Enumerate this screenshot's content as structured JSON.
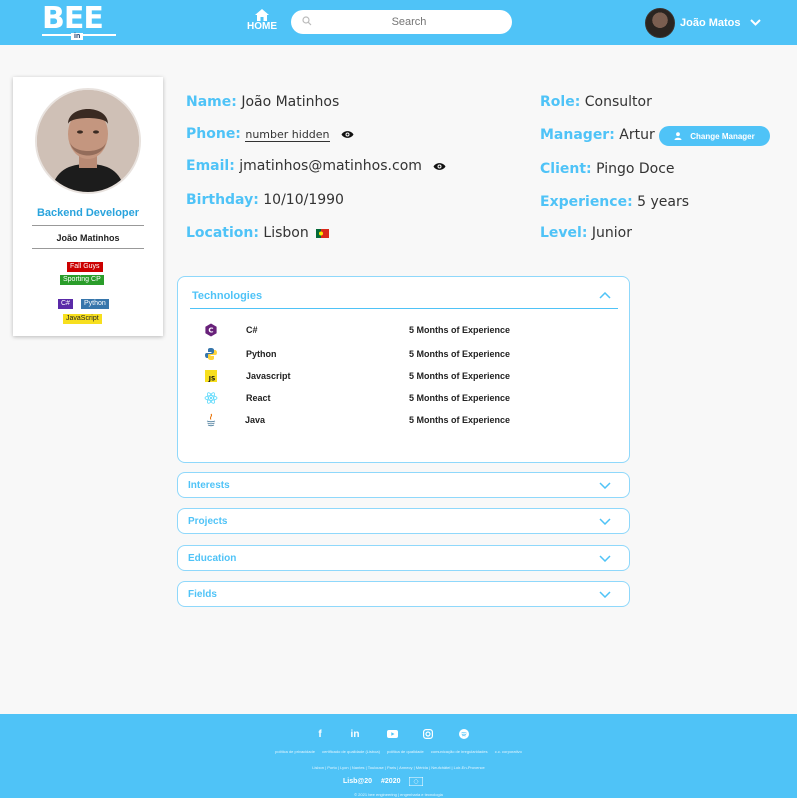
{
  "header": {
    "logo": "BEE",
    "logo_sub": "in",
    "home_label": "HOME",
    "search_placeholder": "Search",
    "user_name": "João Matos"
  },
  "profile": {
    "role": "Backend Developer",
    "name": "João Matinhos",
    "interest_tags": [
      "Fall Guys",
      "Sporting CP"
    ],
    "tech_tags": [
      "C#",
      "Python",
      "JavaScript"
    ]
  },
  "info": {
    "name_label": "Name:",
    "name_value": "João Matinhos",
    "phone_label": "Phone:",
    "phone_value": "number hidden",
    "email_label": "Email:",
    "email_value": "jmatinhos@matinhos.com",
    "birthday_label": "Birthday:",
    "birthday_value": "10/10/1990",
    "location_label": "Location:",
    "location_value": "Lisbon",
    "role_label": "Role:",
    "role_value": "Consultor",
    "manager_label": "Manager:",
    "manager_value": "Artur",
    "change_manager": "Change Manager",
    "client_label": "Client:",
    "client_value": "Pingo Doce",
    "experience_label": "Experience:",
    "experience_value": "5 years",
    "level_label": "Level:",
    "level_value": "Junior"
  },
  "technologies": {
    "title": "Technologies",
    "items": [
      {
        "name": "C#",
        "experience": "5 Months of Experience",
        "icon": "csharp-icon"
      },
      {
        "name": "Python",
        "experience": "5 Months of Experience",
        "icon": "python-icon"
      },
      {
        "name": "Javascript",
        "experience": "5 Months of Experience",
        "icon": "javascript-icon"
      },
      {
        "name": "React",
        "experience": "5 Months of Experience",
        "icon": "react-icon"
      },
      {
        "name": "Java",
        "experience": "5 Months of Experience",
        "icon": "java-icon"
      }
    ]
  },
  "sections": [
    "Interests",
    "Projects",
    "Education",
    "Fields"
  ],
  "footer": {
    "socials": [
      "facebook-icon",
      "linkedin-icon",
      "youtube-icon",
      "instagram-icon",
      "spotify-icon"
    ],
    "links": [
      "política de privacidade",
      "certificado de qualidade (Lisboa)",
      "política de qualidade",
      "comunicação de irregularidades",
      "c.c. corporativo"
    ],
    "offices": "Lisbon | Porto | Lyon | Nantes | Toulouse | Paris | Annecy | Mérida | Neufchâtel | Loir-En-Provence",
    "logos": [
      "Lisb@20",
      "#2020"
    ],
    "copyright": "© 2021 bee engineering | engenharia e tecnologia"
  },
  "colors": {
    "accent": "#4fc3f7",
    "title": "#29a3dc"
  }
}
